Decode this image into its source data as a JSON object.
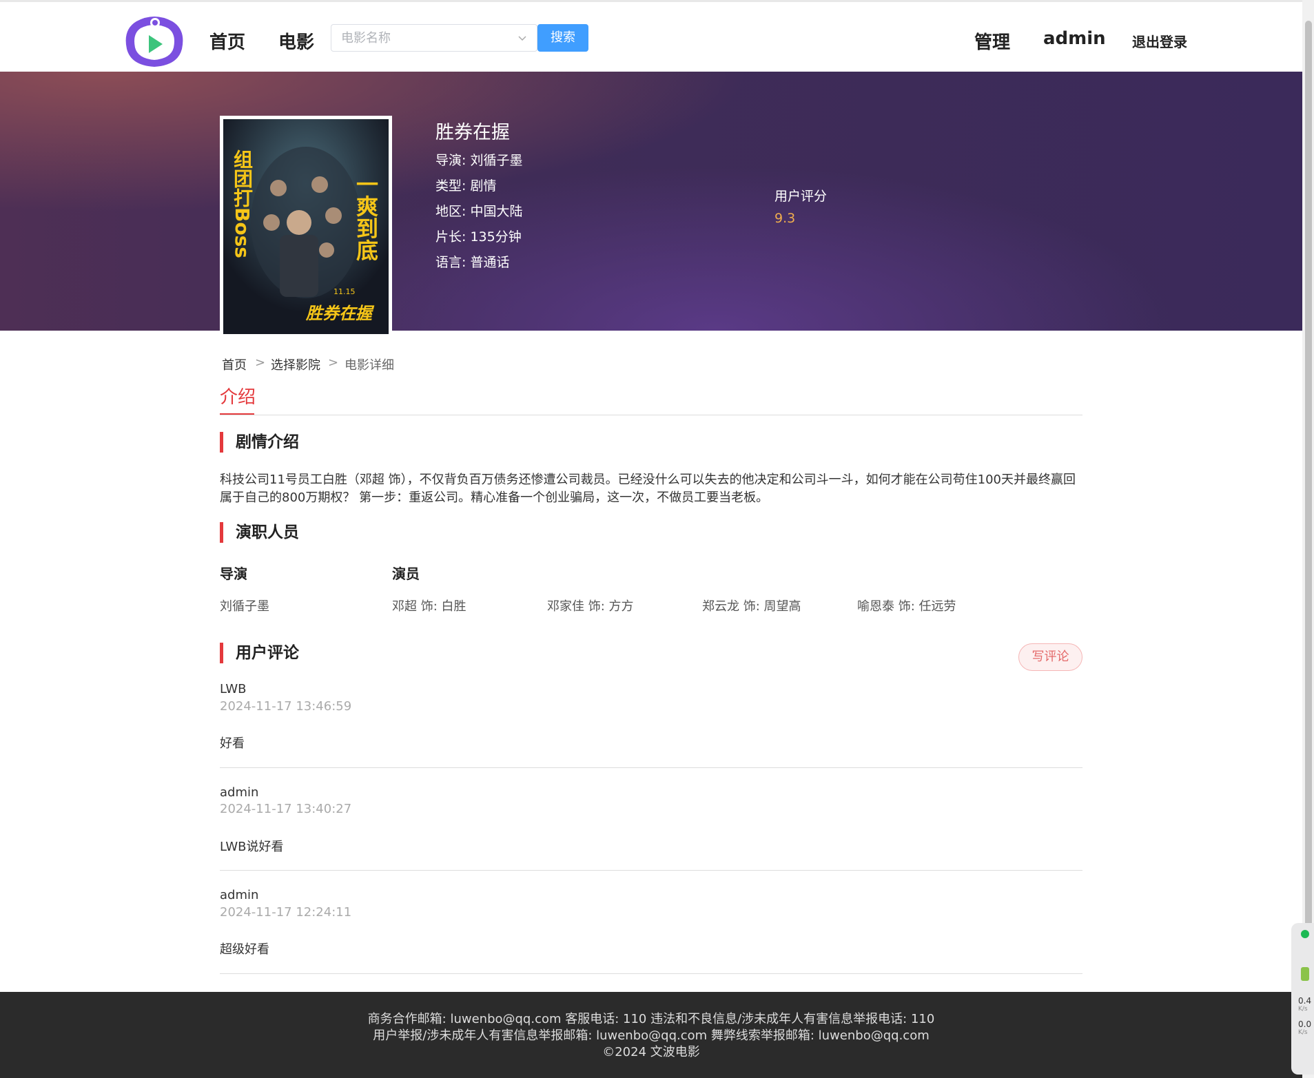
{
  "header": {
    "nav": [
      "首页",
      "电影"
    ],
    "search_placeholder": "电影名称",
    "search_button": "搜索",
    "manage": "管理",
    "username": "admin",
    "logout": "退出登录"
  },
  "movie": {
    "title": "胜券在握",
    "director": "导演: 刘循子墨",
    "genre": "类型: 剧情",
    "region": "地区: 中国大陆",
    "duration": "片长: 135分钟",
    "language": "语言: 普通话",
    "rating_label": "用户评分",
    "rating_value": "9.3"
  },
  "poster": {
    "left_text": "组团打Boss",
    "right_text": "一爽到底",
    "bottom_text": "胜券在握",
    "date_text": "11.15"
  },
  "breadcrumb": [
    "首页",
    "选择影院",
    "电影详细"
  ],
  "breadcrumb_sep": ">",
  "tab": "介绍",
  "sections": {
    "synopsis_title": "剧情介绍",
    "cast_title": "演职人员",
    "comments_title": "用户评论"
  },
  "synopsis": "科技公司11号员工白胜（邓超 饰），不仅背负百万债务还惨遭公司裁员。已经没什么可以失去的他决定和公司斗一斗，如何才能在公司苟住100天并最终赢回属于自己的800万期权？ 第一步：重返公司。精心准备一个创业骗局，这一次，不做员工要当老板。",
  "cast": {
    "director_head": "导演",
    "actor_head": "演员",
    "director": "刘循子墨",
    "actors": [
      "邓超 饰: 白胜",
      "邓家佳 饰: 方方",
      "郑云龙 饰: 周望高",
      "喻恩泰 饰: 任远劳"
    ]
  },
  "write_review": "写评论",
  "comments": [
    {
      "user": "LWB",
      "time": "2024-11-17 13:46:59",
      "text": "好看"
    },
    {
      "user": "admin",
      "time": "2024-11-17 13:40:27",
      "text": "LWB说好看"
    },
    {
      "user": "admin",
      "time": "2024-11-17 12:24:11",
      "text": "超级好看"
    }
  ],
  "footer": {
    "line1": "商务合作邮箱: luwenbo@qq.com 客服电话: 110 违法和不良信息/涉未成年人有害信息举报电话: 110",
    "line2": "用户举报/涉未成年人有害信息举报邮箱: luwenbo@qq.com 舞弊线索举报邮箱: luwenbo@qq.com",
    "line3": "©2024 文波电影"
  },
  "widget": {
    "up": "0.4",
    "down": "0.0",
    "unit": "K/s"
  },
  "colors": {
    "accent": "#e4393c",
    "button": "#409eff",
    "rating": "#f0ad4e",
    "footer_bg": "#2b2b2b"
  }
}
